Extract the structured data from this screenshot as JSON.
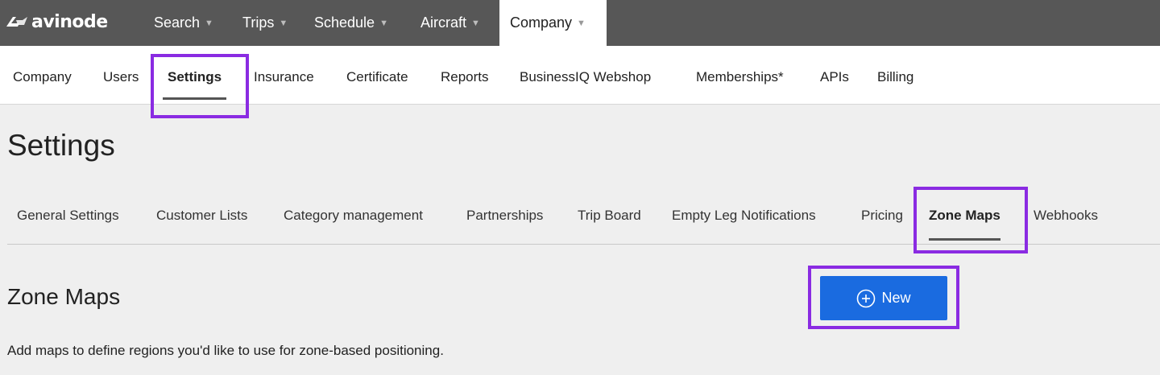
{
  "brand": {
    "name": "avinode",
    "logo_icon": "avinode-logo-icon"
  },
  "top_nav": [
    {
      "label": "Search",
      "has_dropdown": true
    },
    {
      "label": "Trips",
      "has_dropdown": true
    },
    {
      "label": "Schedule",
      "has_dropdown": true
    },
    {
      "label": "Aircraft",
      "has_dropdown": true
    },
    {
      "label": "Company",
      "has_dropdown": true,
      "active": true
    }
  ],
  "sub_nav": [
    {
      "label": "Company"
    },
    {
      "label": "Users"
    },
    {
      "label": "Settings",
      "active": true
    },
    {
      "label": "Insurance"
    },
    {
      "label": "Certificate"
    },
    {
      "label": "Reports"
    },
    {
      "label": "BusinessIQ Webshop"
    },
    {
      "label": "Memberships*"
    },
    {
      "label": "APIs"
    },
    {
      "label": "Billing"
    }
  ],
  "page_title": "Settings",
  "settings_tabs": [
    {
      "label": "General Settings"
    },
    {
      "label": "Customer Lists"
    },
    {
      "label": "Category management"
    },
    {
      "label": "Partnerships"
    },
    {
      "label": "Trip Board"
    },
    {
      "label": "Empty Leg Notifications"
    },
    {
      "label": "Pricing"
    },
    {
      "label": "Zone Maps",
      "active": true
    },
    {
      "label": "Webhooks"
    }
  ],
  "section": {
    "title": "Zone Maps",
    "description": "Add maps to define regions you'd like to use for zone-based positioning.",
    "new_button_label": "New",
    "new_button_icon": "plus-circle-icon"
  },
  "colors": {
    "top_nav_bg": "#575757",
    "primary_button": "#1a6be0",
    "highlight": "#8a2be2",
    "page_bg": "#efefef"
  }
}
